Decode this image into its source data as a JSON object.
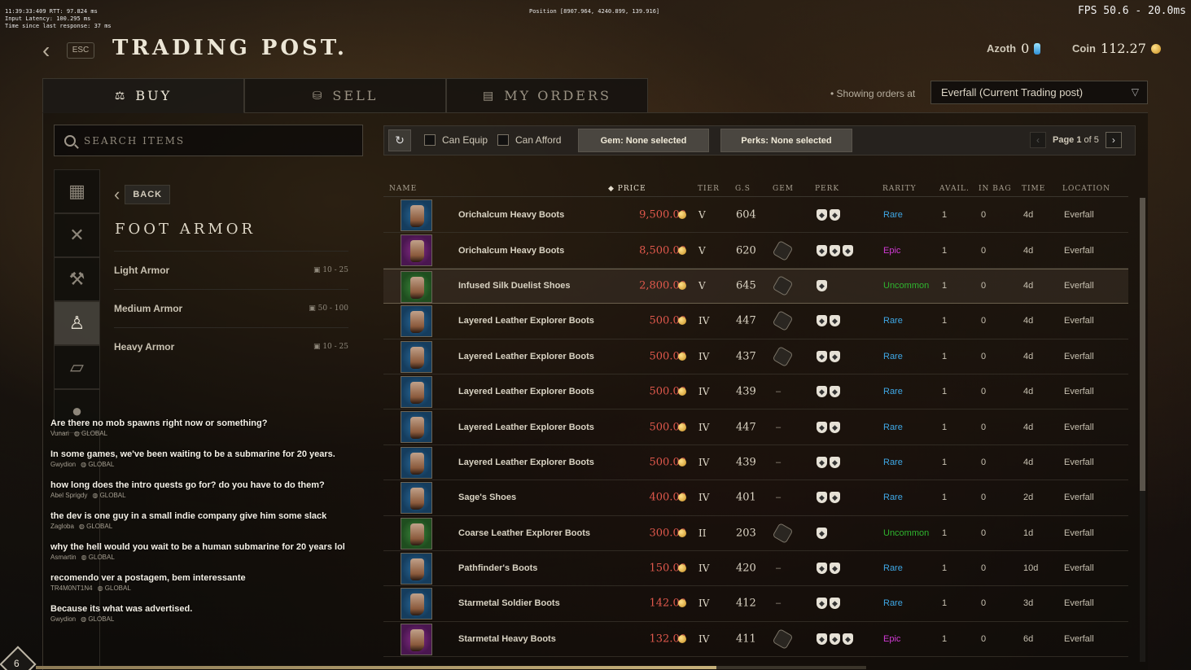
{
  "debug": {
    "line1": "11:39:33:409  RTT: 97.824 ms",
    "line2": "Input Latency: 100.295 ms",
    "line3": "Time since last response:   37 ms",
    "position": "Position [8907.964, 4240.899, 139.916]",
    "fps": "FPS 50.6 - 20.0ms"
  },
  "header": {
    "esc_label": "ESC",
    "title": "TRADING POST.",
    "azoth_label": "Azoth",
    "azoth_value": "0",
    "coin_label": "Coin",
    "coin_value": "112.27"
  },
  "tabs": [
    {
      "label": "BUY",
      "icon": "scale-icon",
      "glyph": "⚖"
    },
    {
      "label": "SELL",
      "icon": "coins-icon",
      "glyph": "⛁"
    },
    {
      "label": "MY ORDERS",
      "icon": "ledger-icon",
      "glyph": "▤"
    }
  ],
  "showing_label": "Showing orders at",
  "location_value": "Everfall (Current Trading post)",
  "search": {
    "placeholder": "SEARCH ITEMS"
  },
  "category_rail": [
    {
      "icon": "grid-icon",
      "glyph": "▦"
    },
    {
      "icon": "crossed-swords-icon",
      "glyph": "✕"
    },
    {
      "icon": "pickaxe-icon",
      "glyph": "⚒"
    },
    {
      "icon": "armor-icon",
      "glyph": "♙"
    },
    {
      "icon": "book-icon",
      "glyph": "▱"
    },
    {
      "icon": "bag-icon",
      "glyph": "●"
    }
  ],
  "back_label": "BACK",
  "category_title": "FOOT ARMOR",
  "subcategories": [
    {
      "label": "Light Armor",
      "gs": "10 - 25"
    },
    {
      "label": "Medium Armor",
      "gs": "50 - 100"
    },
    {
      "label": "Heavy Armor",
      "gs": "10 - 25"
    }
  ],
  "filters": {
    "can_equip": "Can Equip",
    "can_afford": "Can Afford",
    "gem": "Gem: None selected",
    "perks": "Perks: None selected",
    "page_label": "Page",
    "page_current": "1",
    "page_of": "of 5"
  },
  "columns": {
    "name": "NAME",
    "price": "PRICE",
    "tier": "TIER",
    "gs": "G.S",
    "gem": "GEM",
    "perk": "PERK",
    "rarity": "RARITY",
    "avail": "AVAIL.",
    "inbag": "IN BAG",
    "time": "TIME",
    "location": "LOCATION"
  },
  "rarity_colors": {
    "Rare": "#3fa8e6",
    "Epic": "#d23ad6",
    "Uncommon": "#2fb52f"
  },
  "listings": [
    {
      "name": "Orichalcum Heavy Boots",
      "price": "9,500.00",
      "tier": "V",
      "gs": "604",
      "gem": "",
      "perks": 2,
      "rarity": "Rare",
      "avail": "1",
      "inbag": "0",
      "time": "4d",
      "location": "Everfall"
    },
    {
      "name": "Orichalcum Heavy Boots",
      "price": "8,500.00",
      "tier": "V",
      "gs": "620",
      "gem": "socket",
      "perks": 3,
      "rarity": "Epic",
      "avail": "1",
      "inbag": "0",
      "time": "4d",
      "location": "Everfall"
    },
    {
      "name": "Infused Silk Duelist Shoes",
      "price": "2,800.00",
      "tier": "V",
      "gs": "645",
      "gem": "socket",
      "perks": 1,
      "rarity": "Uncommon",
      "avail": "1",
      "inbag": "0",
      "time": "4d",
      "location": "Everfall"
    },
    {
      "name": "Layered Leather Explorer Boots",
      "price": "500.00",
      "tier": "IV",
      "gs": "447",
      "gem": "socket",
      "perks": 2,
      "rarity": "Rare",
      "avail": "1",
      "inbag": "0",
      "time": "4d",
      "location": "Everfall"
    },
    {
      "name": "Layered Leather Explorer Boots",
      "price": "500.00",
      "tier": "IV",
      "gs": "437",
      "gem": "socket",
      "perks": 2,
      "rarity": "Rare",
      "avail": "1",
      "inbag": "0",
      "time": "4d",
      "location": "Everfall"
    },
    {
      "name": "Layered Leather Explorer Boots",
      "price": "500.00",
      "tier": "IV",
      "gs": "439",
      "gem": "–",
      "perks": 2,
      "rarity": "Rare",
      "avail": "1",
      "inbag": "0",
      "time": "4d",
      "location": "Everfall"
    },
    {
      "name": "Layered Leather Explorer Boots",
      "price": "500.00",
      "tier": "IV",
      "gs": "447",
      "gem": "–",
      "perks": 2,
      "rarity": "Rare",
      "avail": "1",
      "inbag": "0",
      "time": "4d",
      "location": "Everfall"
    },
    {
      "name": "Layered Leather Explorer Boots",
      "price": "500.00",
      "tier": "IV",
      "gs": "439",
      "gem": "–",
      "perks": 2,
      "rarity": "Rare",
      "avail": "1",
      "inbag": "0",
      "time": "4d",
      "location": "Everfall"
    },
    {
      "name": "Sage's Shoes",
      "price": "400.00",
      "tier": "IV",
      "gs": "401",
      "gem": "–",
      "perks": 2,
      "rarity": "Rare",
      "avail": "1",
      "inbag": "0",
      "time": "2d",
      "location": "Everfall"
    },
    {
      "name": "Coarse Leather Explorer Boots",
      "price": "300.00",
      "tier": "II",
      "gs": "203",
      "gem": "socket",
      "perks": 1,
      "rarity": "Uncommon",
      "avail": "1",
      "inbag": "0",
      "time": "1d",
      "location": "Everfall"
    },
    {
      "name": "Pathfinder's Boots",
      "price": "150.00",
      "tier": "IV",
      "gs": "420",
      "gem": "–",
      "perks": 2,
      "rarity": "Rare",
      "avail": "1",
      "inbag": "0",
      "time": "10d",
      "location": "Everfall"
    },
    {
      "name": "Starmetal Soldier Boots",
      "price": "142.00",
      "tier": "IV",
      "gs": "412",
      "gem": "–",
      "perks": 2,
      "rarity": "Rare",
      "avail": "1",
      "inbag": "0",
      "time": "3d",
      "location": "Everfall"
    },
    {
      "name": "Starmetal Heavy Boots",
      "price": "132.00",
      "tier": "IV",
      "gs": "411",
      "gem": "socket",
      "perks": 3,
      "rarity": "Epic",
      "avail": "1",
      "inbag": "0",
      "time": "6d",
      "location": "Everfall"
    }
  ],
  "chat": [
    {
      "text": "Are there no mob spawns right now or something?",
      "user": "Vunari",
      "channel": "GLOBAL"
    },
    {
      "text": "In some games, we've been waiting to be a submarine for 20 years.",
      "user": "Gwydion",
      "channel": "GLOBAL"
    },
    {
      "text": "how long does the intro quests go for?  do you have to do them?",
      "user": "Abel Sprigdy",
      "channel": "GLOBAL"
    },
    {
      "text": "the dev is one guy in a small indie company give him some slack",
      "user": "Zagloba",
      "channel": "GLOBAL"
    },
    {
      "text": "why the hell would you wait to be a human submarine for 20 years lol",
      "user": "Asmartin",
      "channel": "GLOBAL"
    },
    {
      "text": "recomendo ver a postagem, bem interessante",
      "user": "TR4M0NT1N4",
      "channel": "GLOBAL"
    },
    {
      "text": "Because its what was advertised.",
      "user": "Gwydion",
      "channel": "GLOBAL"
    }
  ],
  "level": "6",
  "xp_progress": 0.82
}
